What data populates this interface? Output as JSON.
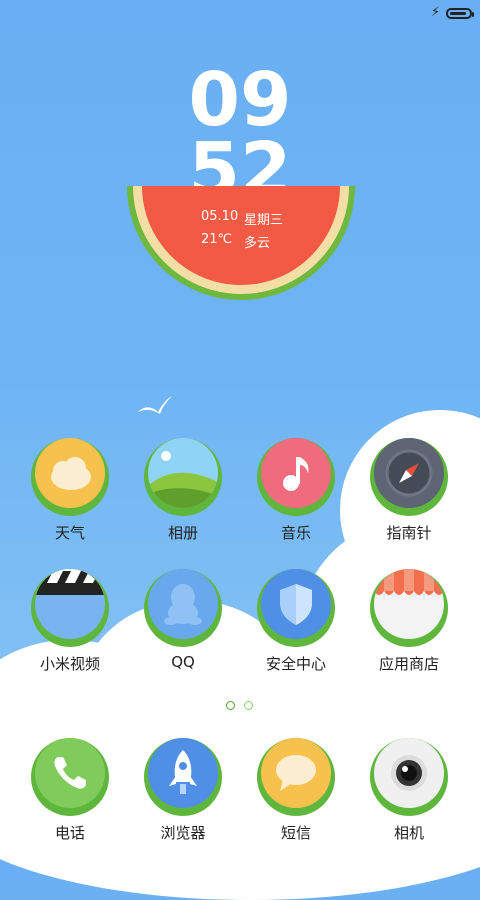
{
  "status_bar": {
    "charging_icon": "bolt-icon",
    "battery_icon": "battery-icon"
  },
  "clock": {
    "hour": "09",
    "minute": "52"
  },
  "weather": {
    "date": "05.10",
    "weekday": "星期三",
    "temp": "21℃",
    "condition": "多云"
  },
  "apps": [
    {
      "label": "天气",
      "icon": "weather-icon"
    },
    {
      "label": "相册",
      "icon": "gallery-icon"
    },
    {
      "label": "音乐",
      "icon": "music-icon"
    },
    {
      "label": "指南针",
      "icon": "compass-icon"
    },
    {
      "label": "小米视频",
      "icon": "video-icon"
    },
    {
      "label": "QQ",
      "icon": "qq-icon"
    },
    {
      "label": "安全中心",
      "icon": "security-icon"
    },
    {
      "label": "应用商店",
      "icon": "app-store-icon"
    }
  ],
  "page_indicator": {
    "count": 2,
    "active": 1
  },
  "dock": [
    {
      "label": "电话",
      "icon": "phone-icon"
    },
    {
      "label": "浏览器",
      "icon": "browser-icon"
    },
    {
      "label": "短信",
      "icon": "sms-icon"
    },
    {
      "label": "相机",
      "icon": "camera-icon"
    }
  ],
  "colors": {
    "sky": "#6fb5f4",
    "melon_rind": "#6fb83e",
    "melon_flesh": "#f25a45",
    "ring": "#5fb63d"
  }
}
